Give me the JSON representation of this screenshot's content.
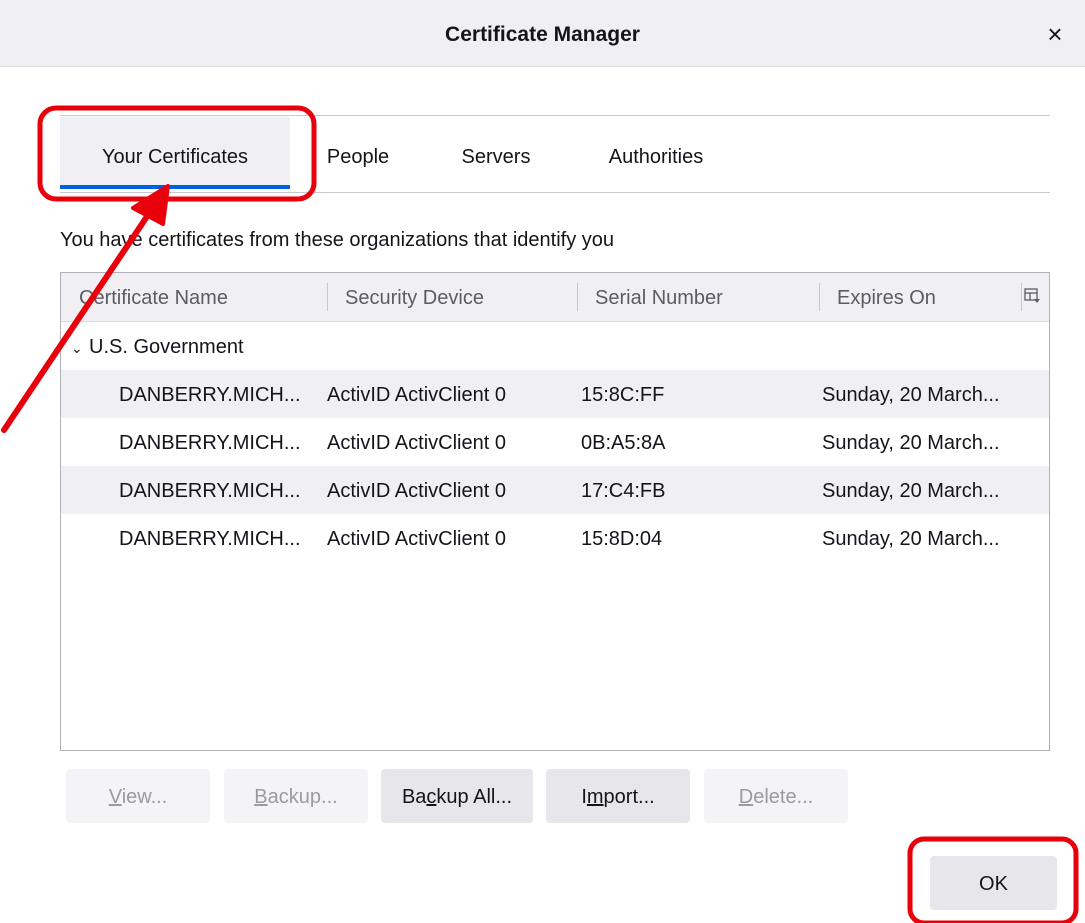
{
  "window": {
    "title": "Certificate Manager",
    "close_label": "×"
  },
  "tabs": [
    {
      "label": "Your Certificates",
      "selected": true
    },
    {
      "label": "People",
      "selected": false
    },
    {
      "label": "Servers",
      "selected": false
    },
    {
      "label": "Authorities",
      "selected": false
    }
  ],
  "description": "You have certificates from these organizations that identify you",
  "table": {
    "columns": [
      "Certificate Name",
      "Security Device",
      "Serial Number",
      "Expires On"
    ],
    "picker_icon": "column-picker-icon",
    "group": {
      "expander": "⌄",
      "label": "U.S. Government",
      "expanded": true
    },
    "rows": [
      {
        "name": "DANBERRY.MICH...",
        "device": "ActivID ActivClient 0",
        "serial": "15:8C:FF",
        "expires": "Sunday, 20 March..."
      },
      {
        "name": "DANBERRY.MICH...",
        "device": "ActivID ActivClient 0",
        "serial": "0B:A5:8A",
        "expires": "Sunday, 20 March..."
      },
      {
        "name": "DANBERRY.MICH...",
        "device": "ActivID ActivClient 0",
        "serial": "17:C4:FB",
        "expires": "Sunday, 20 March..."
      },
      {
        "name": "DANBERRY.MICH...",
        "device": "ActivID ActivClient 0",
        "serial": "15:8D:04",
        "expires": "Sunday, 20 March..."
      }
    ]
  },
  "buttons": {
    "view": {
      "pre": "",
      "key": "V",
      "post": "iew...",
      "enabled": false
    },
    "backup": {
      "pre": "",
      "key": "B",
      "post": "ackup...",
      "enabled": false
    },
    "backup_all": {
      "pre": "Ba",
      "key": "c",
      "post": "kup All...",
      "enabled": true
    },
    "import": {
      "pre": "I",
      "key": "m",
      "post": "port...",
      "enabled": true
    },
    "delete": {
      "pre": "",
      "key": "D",
      "post": "elete...",
      "enabled": false
    },
    "ok": {
      "label": "OK",
      "enabled": true
    }
  },
  "colors": {
    "accent": "#0061e0",
    "annotation": "#e8000b"
  }
}
